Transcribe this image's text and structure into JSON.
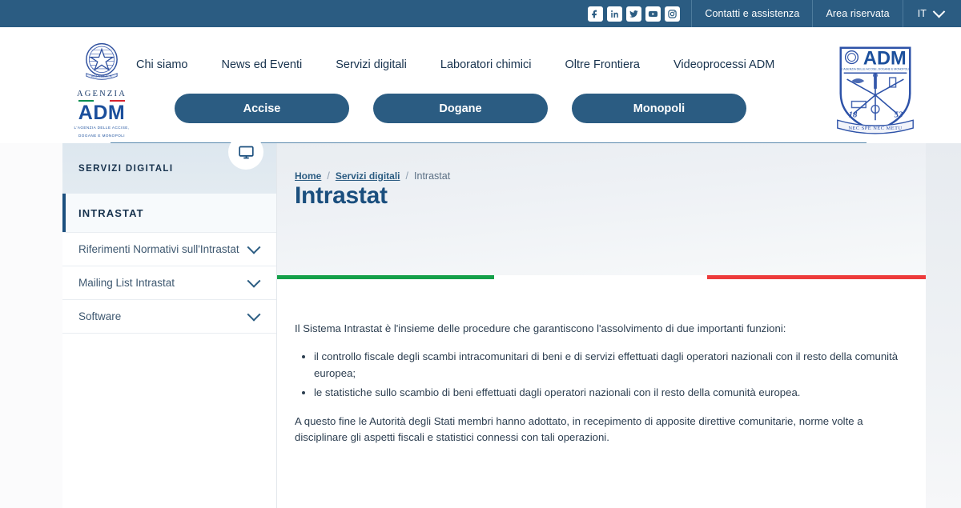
{
  "topbar": {
    "social": [
      {
        "name": "facebook-icon",
        "label": "Facebook"
      },
      {
        "name": "linkedin-icon",
        "label": "LinkedIn"
      },
      {
        "name": "twitter-icon",
        "label": "Twitter"
      },
      {
        "name": "youtube-icon",
        "label": "YouTube"
      },
      {
        "name": "instagram-icon",
        "label": "Instagram"
      }
    ],
    "contacts_label": "Contatti e assistenza",
    "reserved_label": "Area riservata",
    "language": "IT"
  },
  "header": {
    "logo": {
      "agenzia": "AGENZIA",
      "adm": "ADM",
      "subtitle_line1": "L'AGENZIA DELLE ACCISE,",
      "subtitle_line2": "DOGANE E MONOPOLI"
    },
    "crest": {
      "title": "ADM",
      "subtitle": "L'AGENZIA DELLE ACCISE, DOGANE E MONOPOLI",
      "year_left": "18",
      "year_right": "53",
      "motto": "NEC SPE NEC METU"
    },
    "nav": [
      {
        "label": "Chi siamo"
      },
      {
        "label": "News ed Eventi"
      },
      {
        "label": "Servizi digitali"
      },
      {
        "label": "Laboratori chimici"
      },
      {
        "label": "Oltre Frontiera"
      },
      {
        "label": "Videoprocessi ADM"
      }
    ],
    "pills": [
      {
        "label": "Accise"
      },
      {
        "label": "Dogane"
      },
      {
        "label": "Monopoli"
      }
    ]
  },
  "sidebar": {
    "section_title": "SERVIZI DIGITALI",
    "section_icon": "monitor-icon",
    "active_item": "INTRASTAT",
    "items": [
      {
        "label": "Riferimenti Normativi sull'Intrastat",
        "icon": "chevron-down-icon"
      },
      {
        "label": "Mailing List Intrastat",
        "icon": "chevron-down-icon"
      },
      {
        "label": "Software",
        "icon": "chevron-down-icon"
      }
    ]
  },
  "main": {
    "breadcrumb": [
      {
        "label": "Home",
        "link": true
      },
      {
        "label": "Servizi digitali",
        "link": true
      },
      {
        "label": "Intrastat",
        "link": false
      }
    ],
    "breadcrumb_separator": "/",
    "page_title": "Intrastat",
    "tricolor": {
      "green": "#14a049",
      "white": "#ffffff",
      "red": "#ed3b3b"
    },
    "intro": "Il Sistema Intrastat è l'insieme delle procedure che garantiscono l'assolvimento di due importanti funzioni:",
    "bullets": [
      "il controllo fiscale degli scambi intracomunitari di beni e di servizi effettuati dagli operatori nazionali con il resto della comunità europea;",
      "le statistiche sullo scambio di beni effettuati dagli operatori nazionali con il resto della comunità europea."
    ],
    "closing": "A questo fine le Autorità degli Stati membri hanno adottato, in recepimento di apposite direttive comunitarie, norme volte a disciplinare gli aspetti fiscali e statistici connessi con tali operazioni."
  },
  "colors": {
    "topbar_blue": "#2b5c82",
    "accent_blue": "#1b4f7e",
    "text_dark": "#17324d",
    "sidebar_head": "#dfe8ef"
  }
}
